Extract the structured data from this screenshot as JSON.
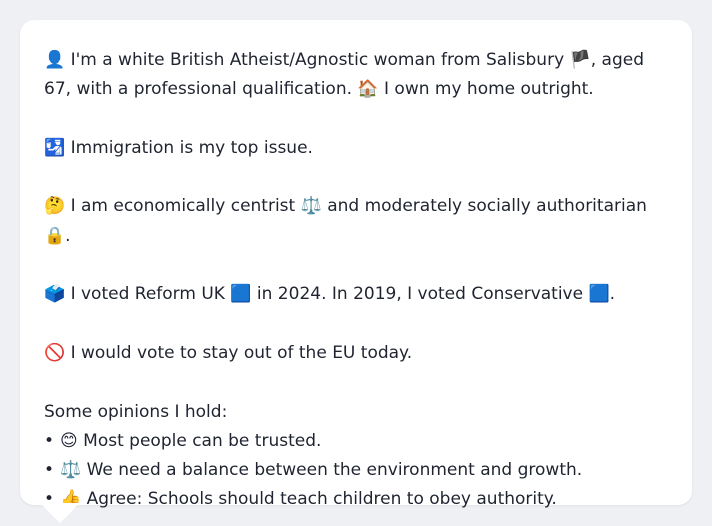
{
  "profile": {
    "intro": {
      "icon": "👤",
      "text_a": "I'm a white British Atheist/Agnostic woman from Salisbury",
      "flag": "🏴",
      "text_b": ", aged 67, with a professional qualification.",
      "home_icon": "🏠",
      "text_c": "I own my home outright."
    },
    "issue": {
      "icon": "🛂",
      "text": "Immigration is my top issue."
    },
    "stance": {
      "icon": "🤔",
      "text_a": "I am economically centrist",
      "scales_icon": "⚖️",
      "text_b": "and moderately socially authoritarian",
      "lock_icon": "🔒",
      "text_c": "."
    },
    "vote": {
      "icon": "🗳️",
      "text_a": "I voted Reform UK",
      "square_a": "🟦",
      "text_b": "in 2024. In 2019, I voted Conservative",
      "square_b": "🟦",
      "text_c": "."
    },
    "eu": {
      "icon": "🚫",
      "text": "I would vote to stay out of the EU today."
    },
    "opinions_heading": "Some opinions I hold:",
    "opinions": [
      {
        "bullet": "•",
        "icon": "😊",
        "text": "Most people can be trusted."
      },
      {
        "bullet": "•",
        "icon": "⚖️",
        "text": "We need a balance between the environment and growth."
      },
      {
        "bullet": "•",
        "icon": "👍",
        "text": "Agree: Schools should teach children to obey authority."
      }
    ]
  },
  "colors": {
    "background": "#eef0f3",
    "card": "#ffffff",
    "text": "#1f2430"
  }
}
